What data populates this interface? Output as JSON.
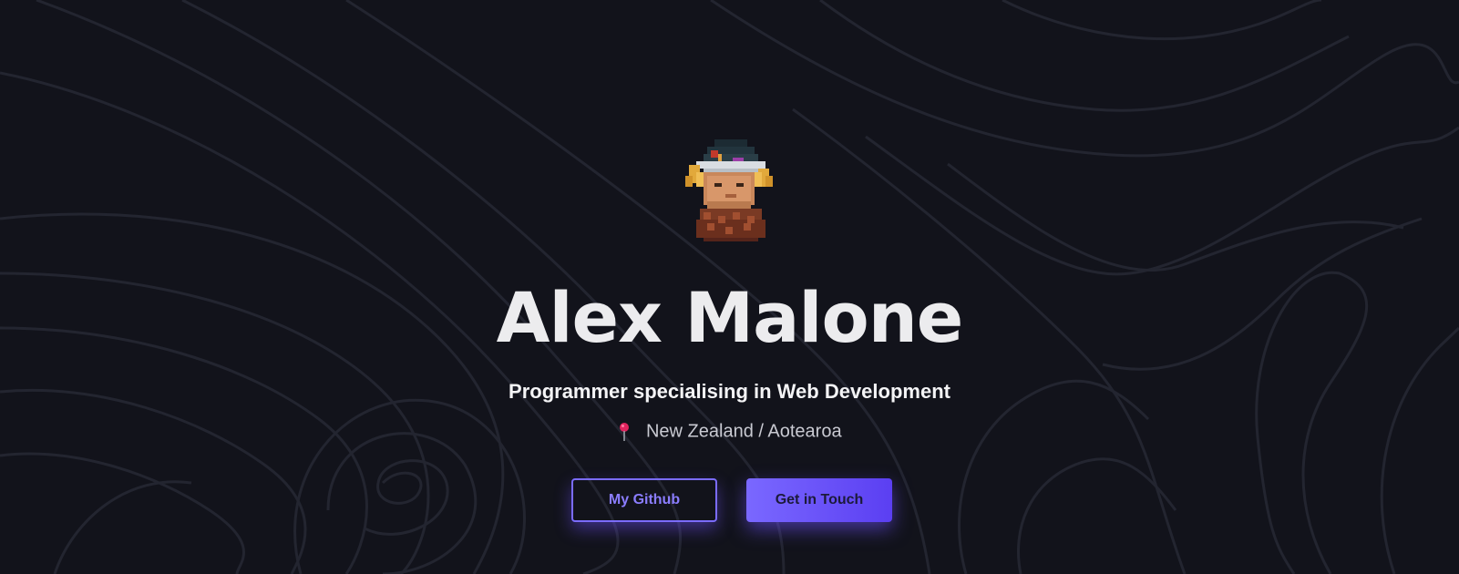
{
  "hero": {
    "name": "Alex Malone",
    "tagline": "Programmer specialising in Web Development",
    "location": "New Zealand / Aotearoa",
    "avatar_icon": "pixel-art-character-avatar",
    "location_icon": "map-pin-icon"
  },
  "buttons": {
    "github_label": "My Github",
    "contact_label": "Get in Touch"
  },
  "colors": {
    "background": "#12131b",
    "accent": "#7b6cff",
    "accent_dark": "#5b3ff2",
    "pin": "#e0245e"
  }
}
